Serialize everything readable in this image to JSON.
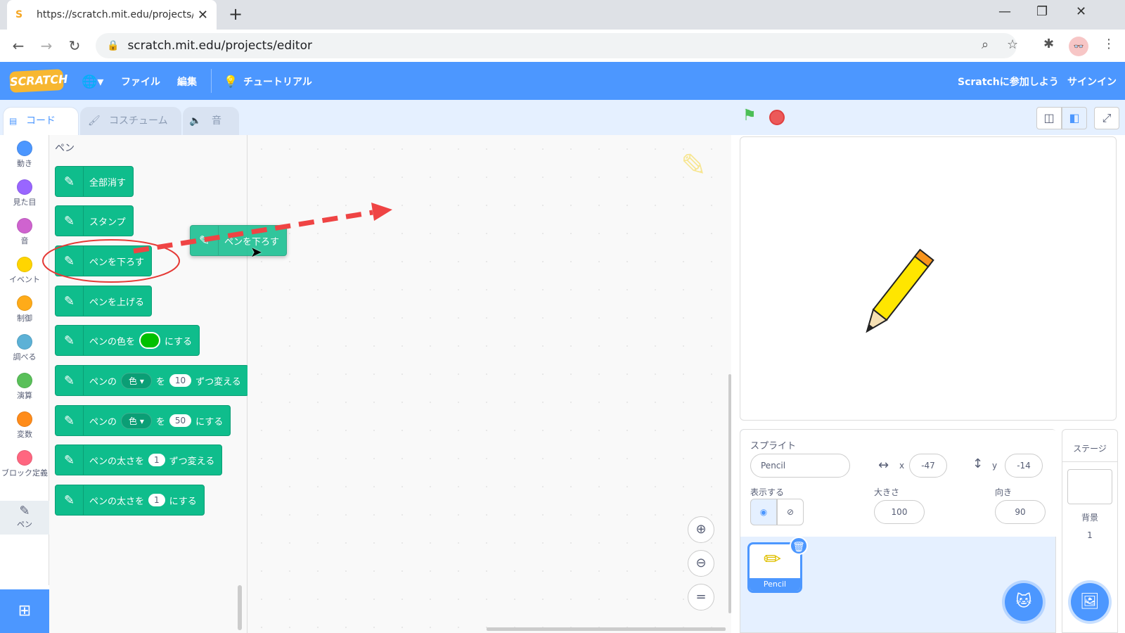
{
  "browser": {
    "tab_title": "https://scratch.mit.edu/projects/e",
    "url": "scratch.mit.edu/projects/editor"
  },
  "menu": {
    "file": "ファイル",
    "edit": "編集",
    "tutorial": "チュートリアル",
    "join": "Scratchに参加しよう",
    "signin": "サインイン",
    "logo": "SCRATCH"
  },
  "tabs": {
    "code": "コード",
    "costume": "コスチューム",
    "sound": "音"
  },
  "categories": [
    {
      "label": "動き",
      "color": "#4c97ff"
    },
    {
      "label": "見た目",
      "color": "#9966ff"
    },
    {
      "label": "音",
      "color": "#cf63cf"
    },
    {
      "label": "イベント",
      "color": "#ffd500"
    },
    {
      "label": "制御",
      "color": "#ffab19"
    },
    {
      "label": "調べる",
      "color": "#5cb1d6"
    },
    {
      "label": "演算",
      "color": "#59c059"
    },
    {
      "label": "変数",
      "color": "#ff8c1a"
    },
    {
      "label": "ブロック定義",
      "color": "#ff6680"
    },
    {
      "label": "ペン",
      "color": "#0fbd8c"
    }
  ],
  "palette": {
    "heading": "ペン",
    "blocks": {
      "clear": "全部消す",
      "stamp": "スタンプ",
      "pen_down": "ペンを下ろす",
      "pen_up": "ペンを上げる",
      "set_color_a": "ペンの色を",
      "set_color_b": "にする",
      "change_a": "ペンの",
      "change_dd": "色",
      "change_b": "を",
      "change_val": "10",
      "change_c": "ずつ変える",
      "set_a": "ペンの",
      "set_dd": "色",
      "set_b": "を",
      "set_val": "50",
      "set_c": "にする",
      "size_change_a": "ペンの太さを",
      "size_change_val": "1",
      "size_change_b": "ずつ変える",
      "size_set_a": "ペンの太さを",
      "size_set_val": "1",
      "size_set_b": "にする"
    }
  },
  "dragged_block": "ペンを下ろす",
  "sprite": {
    "label": "スプライト",
    "name": "Pencil",
    "x_label": "x",
    "x": "-47",
    "y_label": "y",
    "y": "-14",
    "show_label": "表示する",
    "size_label": "大きさ",
    "size": "100",
    "direction_label": "向き",
    "direction": "90",
    "thumb_name": "Pencil"
  },
  "stage_panel": {
    "label": "ステージ",
    "backdrop_label": "背景",
    "backdrop_count": "1"
  }
}
